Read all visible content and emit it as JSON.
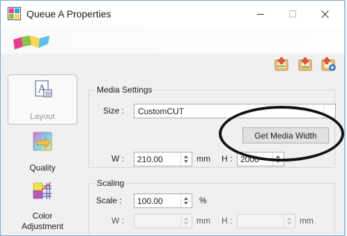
{
  "window": {
    "title": "Queue A Properties",
    "controls": {
      "minimize": "minimize-icon",
      "maximize": "maximize-icon",
      "close": "close-icon"
    }
  },
  "toolbar": {
    "icons": [
      "import-settings-icon",
      "export-settings-icon",
      "add-settings-icon"
    ]
  },
  "sidebar": {
    "items": [
      {
        "label": "Layout",
        "icon": "layout-icon",
        "selected": true
      },
      {
        "label": "Quality",
        "icon": "quality-icon",
        "selected": false
      },
      {
        "label_line1": "Color",
        "label_line2": "Adjustment",
        "icon": "color-adjustment-icon",
        "selected": false
      }
    ]
  },
  "media_settings": {
    "legend": "Media Settings",
    "size_label": "Size :",
    "size_value": "CustomCUT",
    "get_media_width_button": "Get Media Width",
    "w_label": "W :",
    "w_value": "210.00",
    "w_unit": "mm",
    "h_label": "H :",
    "h_value": "2000"
  },
  "scaling": {
    "legend": "Scaling",
    "scale_label": "Scale :",
    "scale_value": "100.00",
    "scale_unit": "%",
    "w_label": "W :",
    "w_value": "",
    "w_unit": "mm",
    "h_label": "H :",
    "h_value": "",
    "h_unit": "mm"
  },
  "colors": {
    "accent_border": "#7aa7d8",
    "callout": "#111111"
  }
}
